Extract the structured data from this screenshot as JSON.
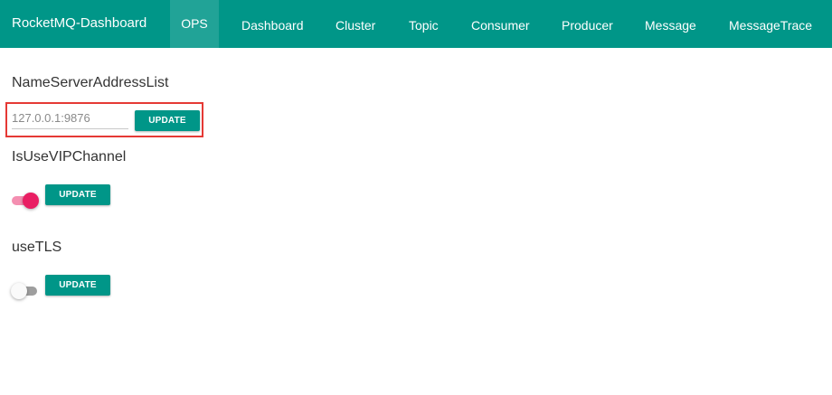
{
  "navbar": {
    "brand": "RocketMQ-Dashboard",
    "items": [
      {
        "label": "OPS",
        "active": true
      },
      {
        "label": "Dashboard"
      },
      {
        "label": "Cluster"
      },
      {
        "label": "Topic"
      },
      {
        "label": "Consumer"
      },
      {
        "label": "Producer"
      },
      {
        "label": "Message"
      },
      {
        "label": "MessageTrace"
      }
    ]
  },
  "sections": {
    "nameserver": {
      "title": "NameServerAddressList",
      "input_value": "127.0.0.1:9876",
      "button_label": "UPDATE"
    },
    "vipchannel": {
      "title": "IsUseVIPChannel",
      "toggle_on": true,
      "button_label": "UPDATE"
    },
    "tls": {
      "title": "useTLS",
      "toggle_on": false,
      "button_label": "UPDATE"
    }
  },
  "colors": {
    "primary": "#009688",
    "toggle_on": "#e91e63",
    "highlight": "#e53935"
  }
}
